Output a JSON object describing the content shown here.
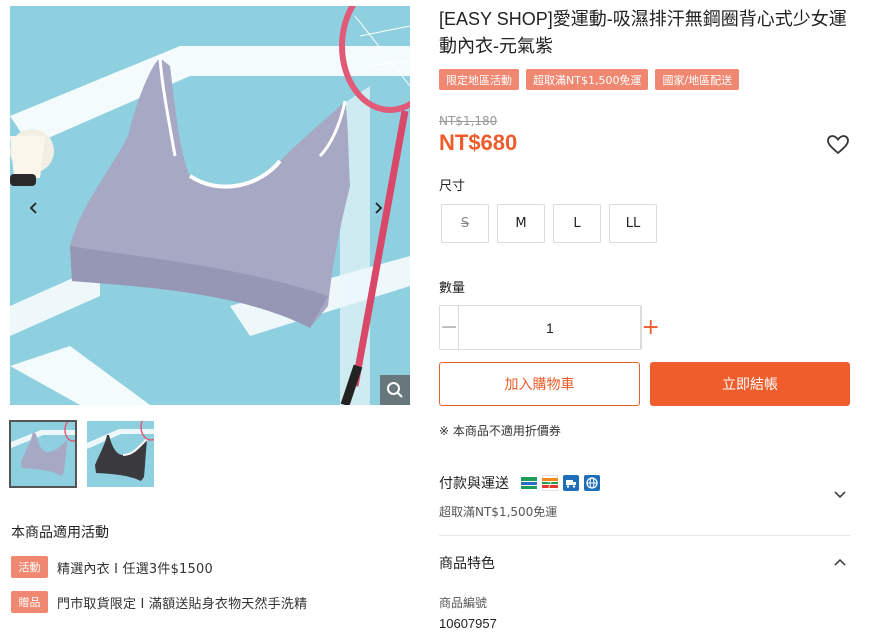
{
  "product": {
    "title": "[EASY SHOP]愛運動-吸濕排汗無鋼圈背心式少女運動內衣-元氣紫",
    "tags": [
      "限定地區活動",
      "超取滿NT$1,500免運",
      "國家/地區配送"
    ],
    "original_price": "NT$1,180",
    "price": "NT$680",
    "favorite_icon": "heart-outline-icon"
  },
  "gallery": {
    "main_image_alt": "purple sports bra on light blue court background with badminton racket and shuttlecock",
    "prev_icon": "chevron-left-icon",
    "next_icon": "chevron-right-icon",
    "zoom_icon": "magnifier-icon",
    "thumbnails": [
      "purple sports bra",
      "black sports bra"
    ]
  },
  "size": {
    "label": "尺寸",
    "options": [
      {
        "label": "S",
        "available": false
      },
      {
        "label": "M",
        "available": true
      },
      {
        "label": "L",
        "available": true
      },
      {
        "label": "LL",
        "available": true
      }
    ]
  },
  "quantity": {
    "label": "數量",
    "minus": "−",
    "value": "1",
    "plus": "+"
  },
  "actions": {
    "add_to_cart": "加入購物車",
    "buy_now": "立即結帳"
  },
  "note": "※ 本商品不適用折價券",
  "shipping": {
    "title": "付款與運送",
    "icons": [
      "familymart-icon",
      "seven-eleven-icon",
      "home-delivery-icon",
      "global-shipping-icon"
    ],
    "subtitle": "超取滿NT$1,500免運",
    "expand_icon": "chevron-down-icon"
  },
  "features": {
    "title": "商品特色",
    "collapse_icon": "chevron-up-icon",
    "spec_label": "商品編號",
    "spec_value": "10607957"
  },
  "promotions": {
    "title": "本商品適用活動",
    "items": [
      {
        "badge": "活動",
        "text": "精選內衣 I 任選3件$1500"
      },
      {
        "badge": "贈品",
        "text": "門市取貨限定 I 滿額送貼身衣物天然手洗精"
      }
    ]
  },
  "colors": {
    "accent": "#ee5d2b",
    "tag": "#f08770",
    "background_image": "#8fd0e0"
  }
}
